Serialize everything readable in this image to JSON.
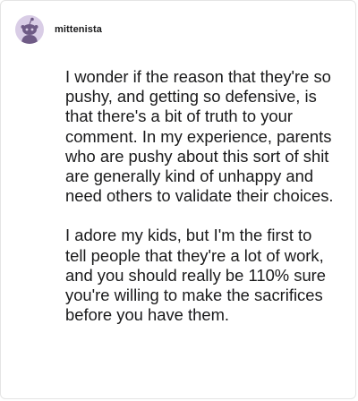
{
  "comment": {
    "username": "mittenista",
    "avatar_icon": "reddit-snoo-avatar-icon",
    "paragraphs": [
      "I wonder if the reason that they're so pushy, and getting so defensive, is that there's a bit of truth to your comment. In my experience, parents who are pushy about this sort of shit are generally kind of unhappy and need others to validate their choices.",
      "I adore my kids, but I'm the first to tell people that they're a lot of work, and you should really be 110% sure you're willing to make the sacrifices before you have them."
    ]
  },
  "colors": {
    "avatar_bg": "#d9cde6",
    "avatar_figure": "#6f5b86",
    "text": "#1a1a1b",
    "border": "#e4e4e4"
  }
}
